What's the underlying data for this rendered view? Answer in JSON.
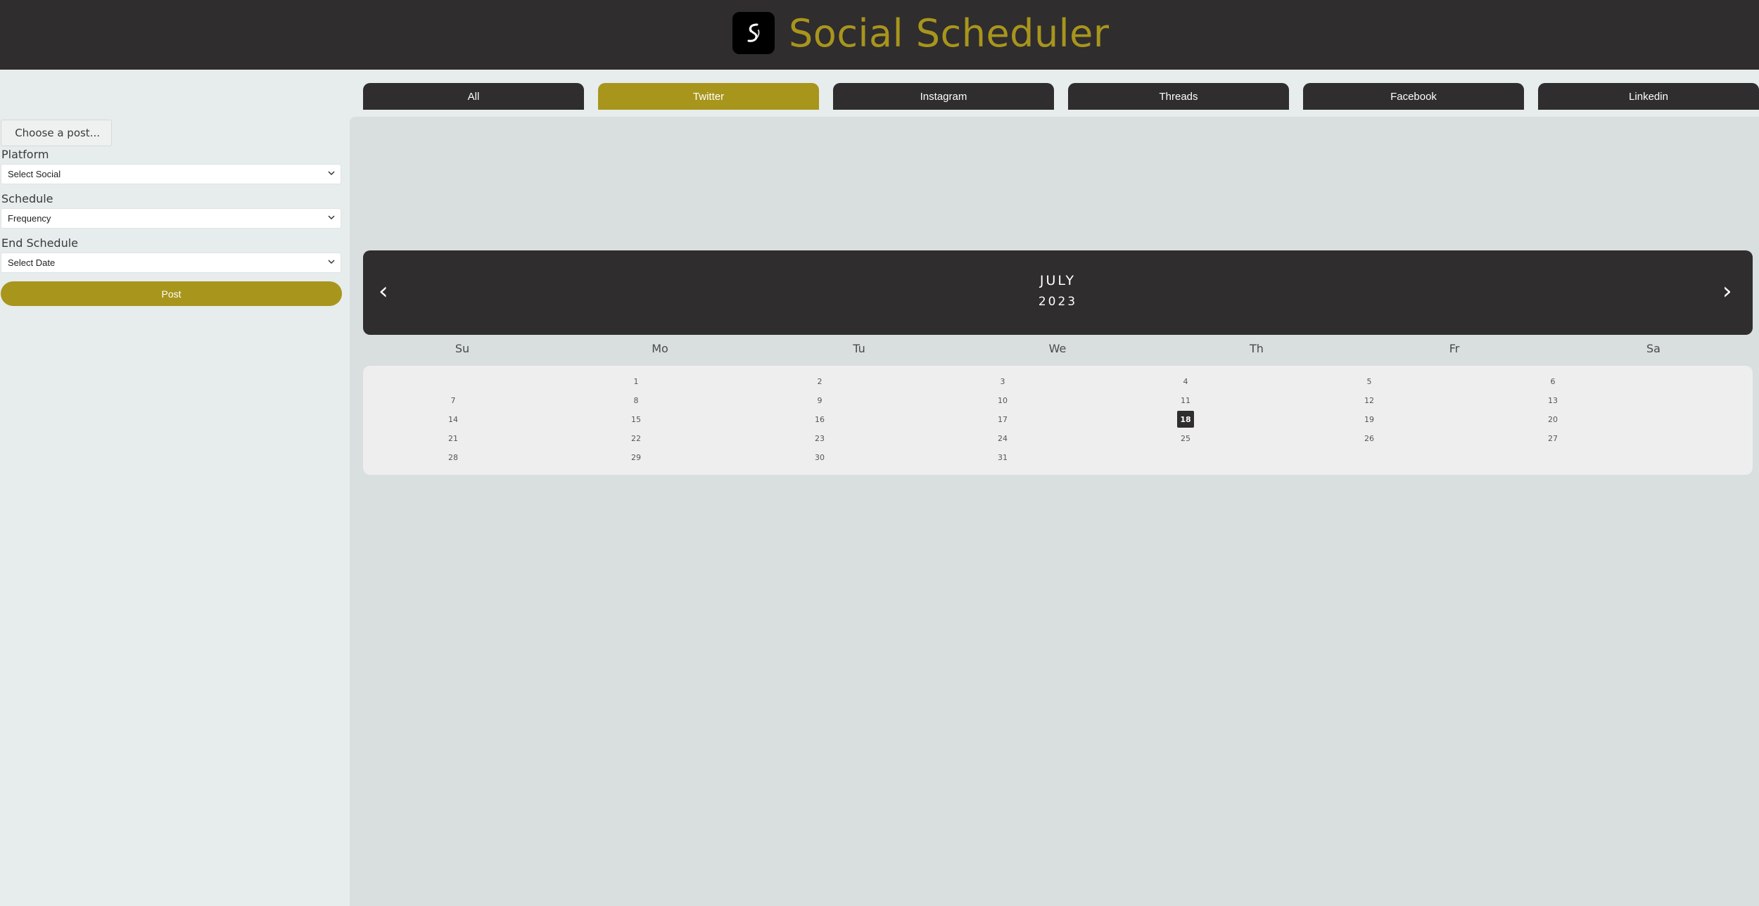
{
  "header": {
    "title": "Social Scheduler",
    "logo_icon": "ss-logo-icon"
  },
  "tabs": [
    {
      "label": "All",
      "active": false
    },
    {
      "label": "Twitter",
      "active": true
    },
    {
      "label": "Instagram",
      "active": false
    },
    {
      "label": "Threads",
      "active": false
    },
    {
      "label": "Facebook",
      "active": false
    },
    {
      "label": "Linkedin",
      "active": false
    }
  ],
  "form": {
    "choose_post_label": "Choose a post...",
    "platform": {
      "label": "Platform",
      "value": "Select Social"
    },
    "schedule": {
      "label": "Schedule",
      "value": "Frequency"
    },
    "end_schedule": {
      "label": "End Schedule",
      "value": "Select Date"
    },
    "post_label": "Post"
  },
  "calendar": {
    "month": "JULY",
    "year": "2023",
    "weekdays": [
      "Su",
      "Mo",
      "Tu",
      "We",
      "Th",
      "Fr",
      "Sa"
    ],
    "weeks": [
      [
        "",
        "1",
        "2",
        "3",
        "4",
        "5",
        "6"
      ],
      [
        "7",
        "8",
        "9",
        "10",
        "11",
        "12",
        "13"
      ],
      [
        "14",
        "15",
        "16",
        "17",
        "18",
        "19",
        "20"
      ],
      [
        "21",
        "22",
        "23",
        "24",
        "25",
        "26",
        "27"
      ],
      [
        "28",
        "29",
        "30",
        "31",
        "",
        "",
        ""
      ]
    ],
    "today": "18",
    "prev_icon": "chevron-left-icon",
    "next_icon": "chevron-right-icon"
  },
  "colors": {
    "accent": "#a8951c",
    "dark": "#2f2d2e",
    "panel": "#d9dede",
    "background": "#e7ecec"
  }
}
